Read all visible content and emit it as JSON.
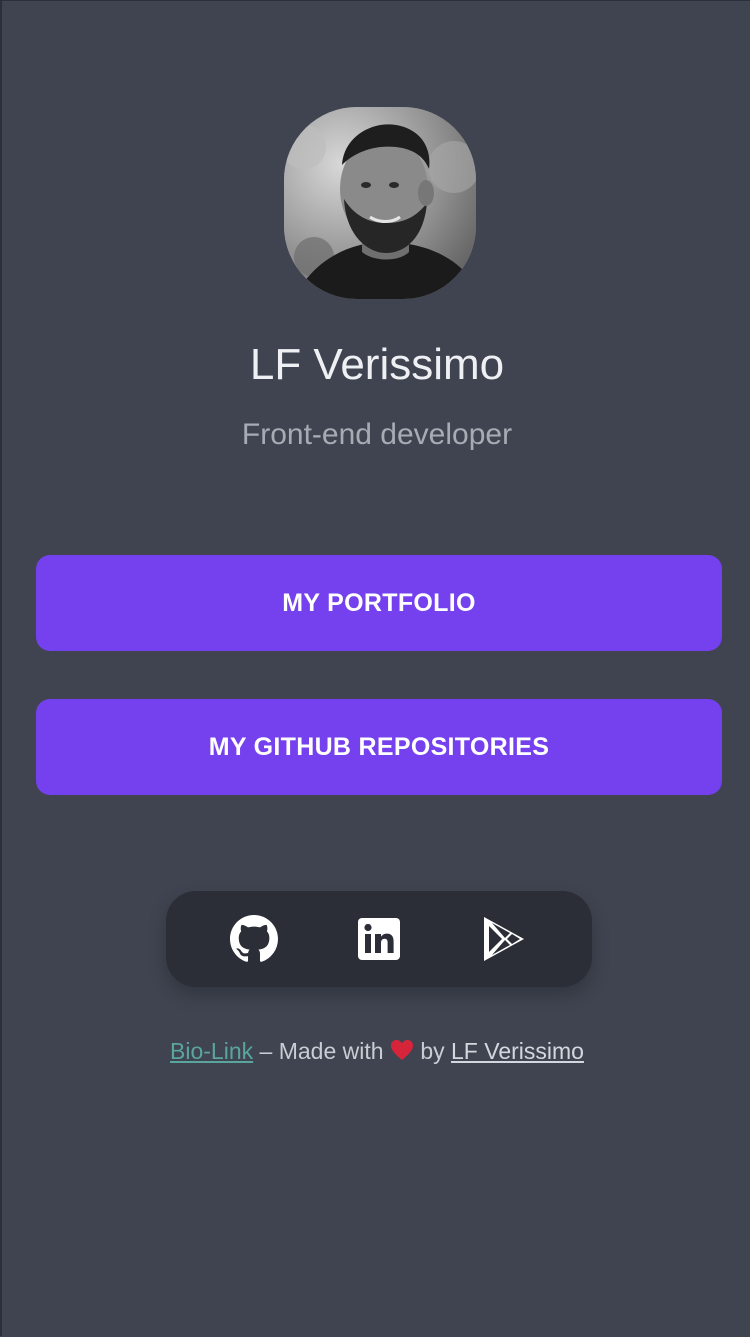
{
  "profile": {
    "name": "LF Verissimo",
    "role": "Front-end developer"
  },
  "links": [
    {
      "label": "MY PORTFOLIO"
    },
    {
      "label": "MY GITHUB REPOSITORIES"
    }
  ],
  "social": [
    {
      "icon": "github-icon"
    },
    {
      "icon": "linkedin-icon"
    },
    {
      "icon": "google-play-icon"
    }
  ],
  "footer": {
    "bio_link": "Bio-Link",
    "made_with": " – Made with ",
    "heart_icon": "heart-icon",
    "by": " by ",
    "author_link": "LF Verissimo"
  },
  "colors": {
    "background": "#3f4450",
    "button": "#7540ee",
    "social_bar": "#2b2e37",
    "bio_link": "#5aa59c",
    "heart": "#d6253a"
  }
}
